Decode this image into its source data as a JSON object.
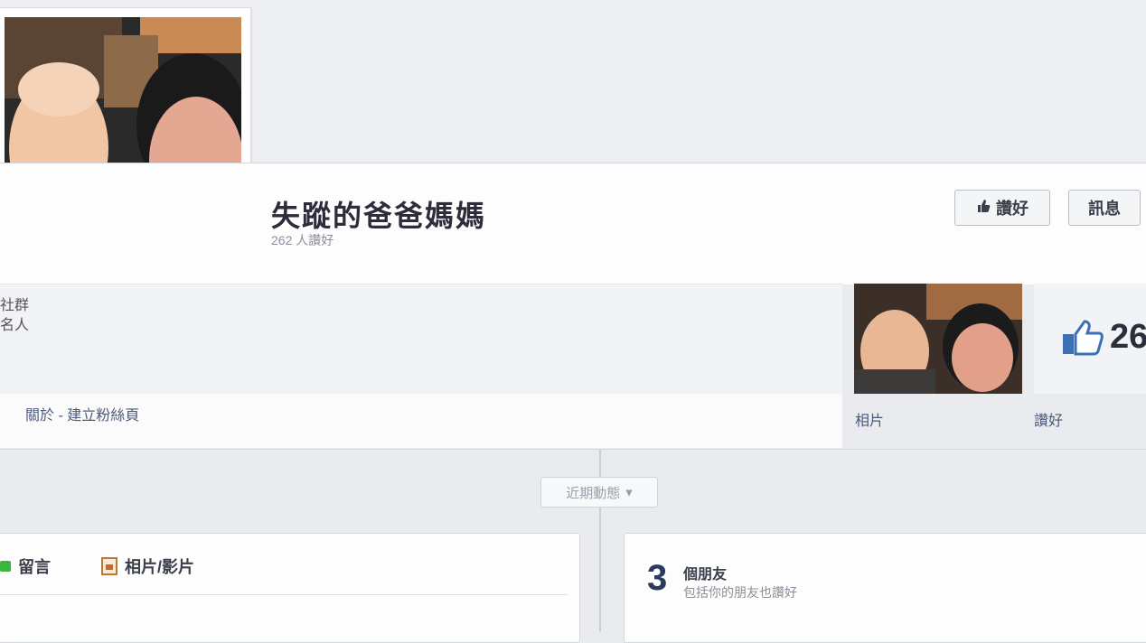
{
  "page": {
    "name": "失蹤的爸爸媽媽",
    "likes_line": "262 人讚好",
    "category_lines": [
      "社群",
      "名人"
    ],
    "about_link": "關於 - 建立粉絲頁",
    "like_button": "讚好",
    "message_button": "訊息"
  },
  "sidebar": {
    "photos_label": "相片",
    "likes_count": "26",
    "likes_label": "讚好"
  },
  "timeline": {
    "pill_label": "近期動態",
    "pill_arrow": "▾"
  },
  "composer": {
    "status_tab": "留言",
    "photo_tab": "相片/影片",
    "status_icon": "status-square-icon",
    "photo_icon": "photo-frame-icon"
  },
  "friends": {
    "count": "3",
    "title": "個朋友",
    "subtitle": "包括你的朋友也讚好"
  },
  "colors": {
    "link": "#4b5a7a",
    "accent_blue": "#3b6fb6",
    "green": "#3bb53b"
  }
}
